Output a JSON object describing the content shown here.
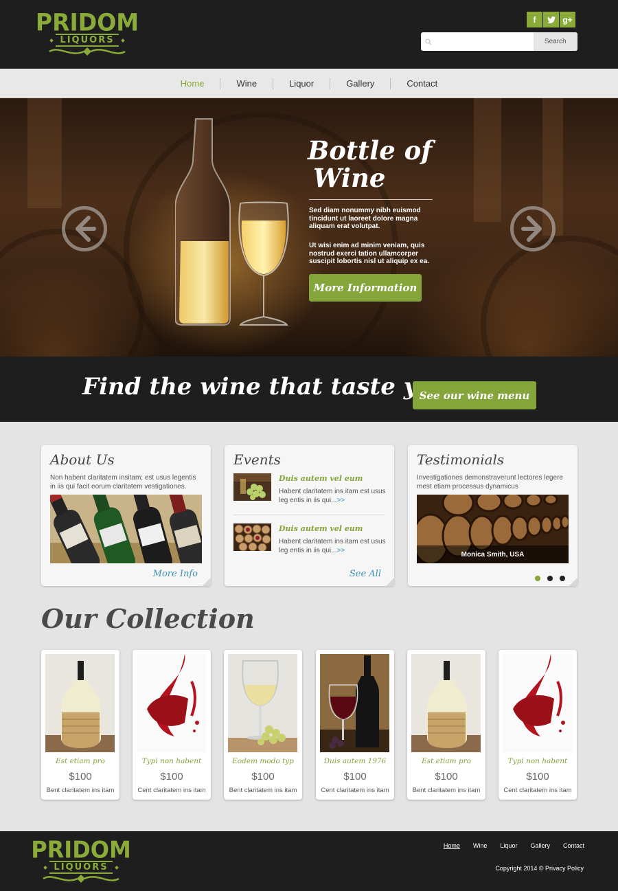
{
  "header": {
    "logo_top": "PRIDOM",
    "logo_bottom": "LIQUORS",
    "social": [
      {
        "icon": "facebook-icon",
        "glyph": "f"
      },
      {
        "icon": "twitter-icon",
        "glyph": "t"
      },
      {
        "icon": "google-plus-icon",
        "glyph": "g+"
      }
    ],
    "search": {
      "placeholder": "",
      "button_label": "Search"
    }
  },
  "nav": {
    "items": [
      {
        "label": "Home",
        "active": true
      },
      {
        "label": "Wine"
      },
      {
        "label": "Liquor"
      },
      {
        "label": "Gallery"
      },
      {
        "label": "Contact"
      }
    ]
  },
  "hero": {
    "title_line1": "Bottle of",
    "title_line2": "Wine",
    "paragraph1": "Sed diam nonummy nibh euismod tincidunt ut laoreet dolore magna aliquam erat volutpat.",
    "paragraph2": "Ut wisi enim ad minim veniam, quis nostrud exerci tation ullamcorper suscipit lobortis nisl ut aliquip ex ea.",
    "button_label": "More Information"
  },
  "tagline": {
    "text": "Find the wine that taste you",
    "button_label": "See our wine menu"
  },
  "about": {
    "title": "About Us",
    "text": "Non habent claritatem insitam; est usus legentis in iis qui facit eorum claritatem vestigationes.",
    "link": "More Info"
  },
  "events": {
    "title": "Events",
    "items": [
      {
        "title": "Duis autem vel eum",
        "text": "Habent claritatem ins itam est usus leg entis in iis qui...",
        "more": ">>"
      },
      {
        "title": "Duis autem vel eum",
        "text": "Habent claritatem ins itam est usus leg entis in iis qui...",
        "more": ">>"
      }
    ],
    "link": "See All"
  },
  "testimonials": {
    "title": "Testimonials",
    "text": "Investigationes demonstraverunt lectores legere mest etiam processus dynamicus",
    "caption": "Monica Smith, USA",
    "dots": 3,
    "active_dot": 0
  },
  "collection": {
    "title": "Our Collection",
    "items": [
      {
        "name": "Est etiam pro",
        "price": "$100",
        "desc": "Bent claritatem ins itam"
      },
      {
        "name": "Typi non habent",
        "price": "$100",
        "desc": "Cent claritatem ins itam"
      },
      {
        "name": "Eodem modo typ",
        "price": "$100",
        "desc": "Bent claritatem ins itam"
      },
      {
        "name": "Duis autem 1976",
        "price": "$100",
        "desc": "Cent claritatem ins itam"
      },
      {
        "name": "Est etiam pro",
        "price": "$100",
        "desc": "Bent claritatem ins itam"
      },
      {
        "name": "Typi non habent",
        "price": "$100",
        "desc": "Cent claritatem ins itam"
      }
    ]
  },
  "footer": {
    "nav": [
      {
        "label": "Home",
        "active": true
      },
      {
        "label": "Wine"
      },
      {
        "label": "Liquor"
      },
      {
        "label": "Gallery"
      },
      {
        "label": "Contact"
      }
    ],
    "copyright": "Copyright 2014 © Privacy Policy"
  },
  "colors": {
    "accent_green": "#84a53a",
    "dark": "#1e1e1e",
    "link_blue": "#3d8fb3"
  }
}
